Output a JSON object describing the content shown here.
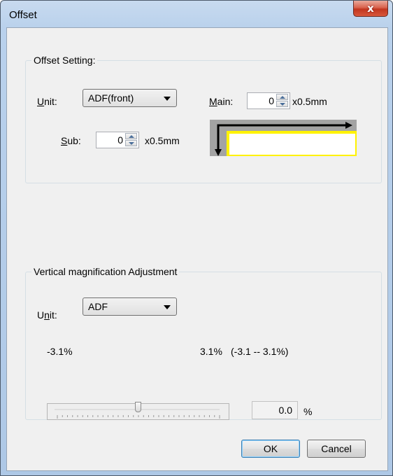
{
  "window": {
    "title": "Offset",
    "close_glyph": "x"
  },
  "offset": {
    "group_label": "Offset Setting:",
    "unit_label_u": "U",
    "unit_label_rest": "nit:",
    "unit_value": "ADF(front)",
    "main_label_u": "M",
    "main_label_rest": "ain:",
    "main_value": "0",
    "main_unit": "x0.5mm",
    "sub_label_u": "S",
    "sub_label_rest": "ub:",
    "sub_value": "0",
    "sub_unit": "x0.5mm"
  },
  "vertical": {
    "group_label": "Vertical magnification Adjustment",
    "unit_label_pre": "U",
    "unit_label_u": "n",
    "unit_label_rest": "it:",
    "unit_value": "ADF",
    "min_label": "-3.1%",
    "max_label": "3.1%",
    "range_label": "(-3.1 -- 3.1%)",
    "slider_value": 0.0,
    "value": "0.0",
    "value_unit": "%"
  },
  "buttons": {
    "ok": "OK",
    "cancel": "Cancel"
  },
  "colors": {
    "diagram_yellow": "#fff200",
    "default_button_border": "#3c7fb1"
  }
}
